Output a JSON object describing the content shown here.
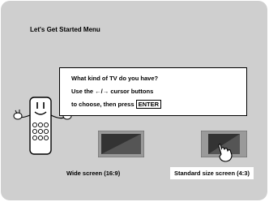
{
  "title": "Let's Get Started Menu",
  "message": {
    "line1": "What kind of TV do you have?",
    "line2": "Use the ←/→ cursor buttons",
    "line3_prefix": "to choose, then press",
    "line3_key": "ENTER"
  },
  "options": [
    {
      "label": "Wide screen (16:9)",
      "selected": false
    },
    {
      "label": "Standard size screen (4:3)",
      "selected": true
    }
  ],
  "colors": {
    "background": "#cfcfcf",
    "tv_frame": "#9a9a9a",
    "tv_screen": "#333333"
  },
  "icons": [
    "remote-mascot-icon",
    "pointing-hand-icon",
    "tv-icon"
  ]
}
